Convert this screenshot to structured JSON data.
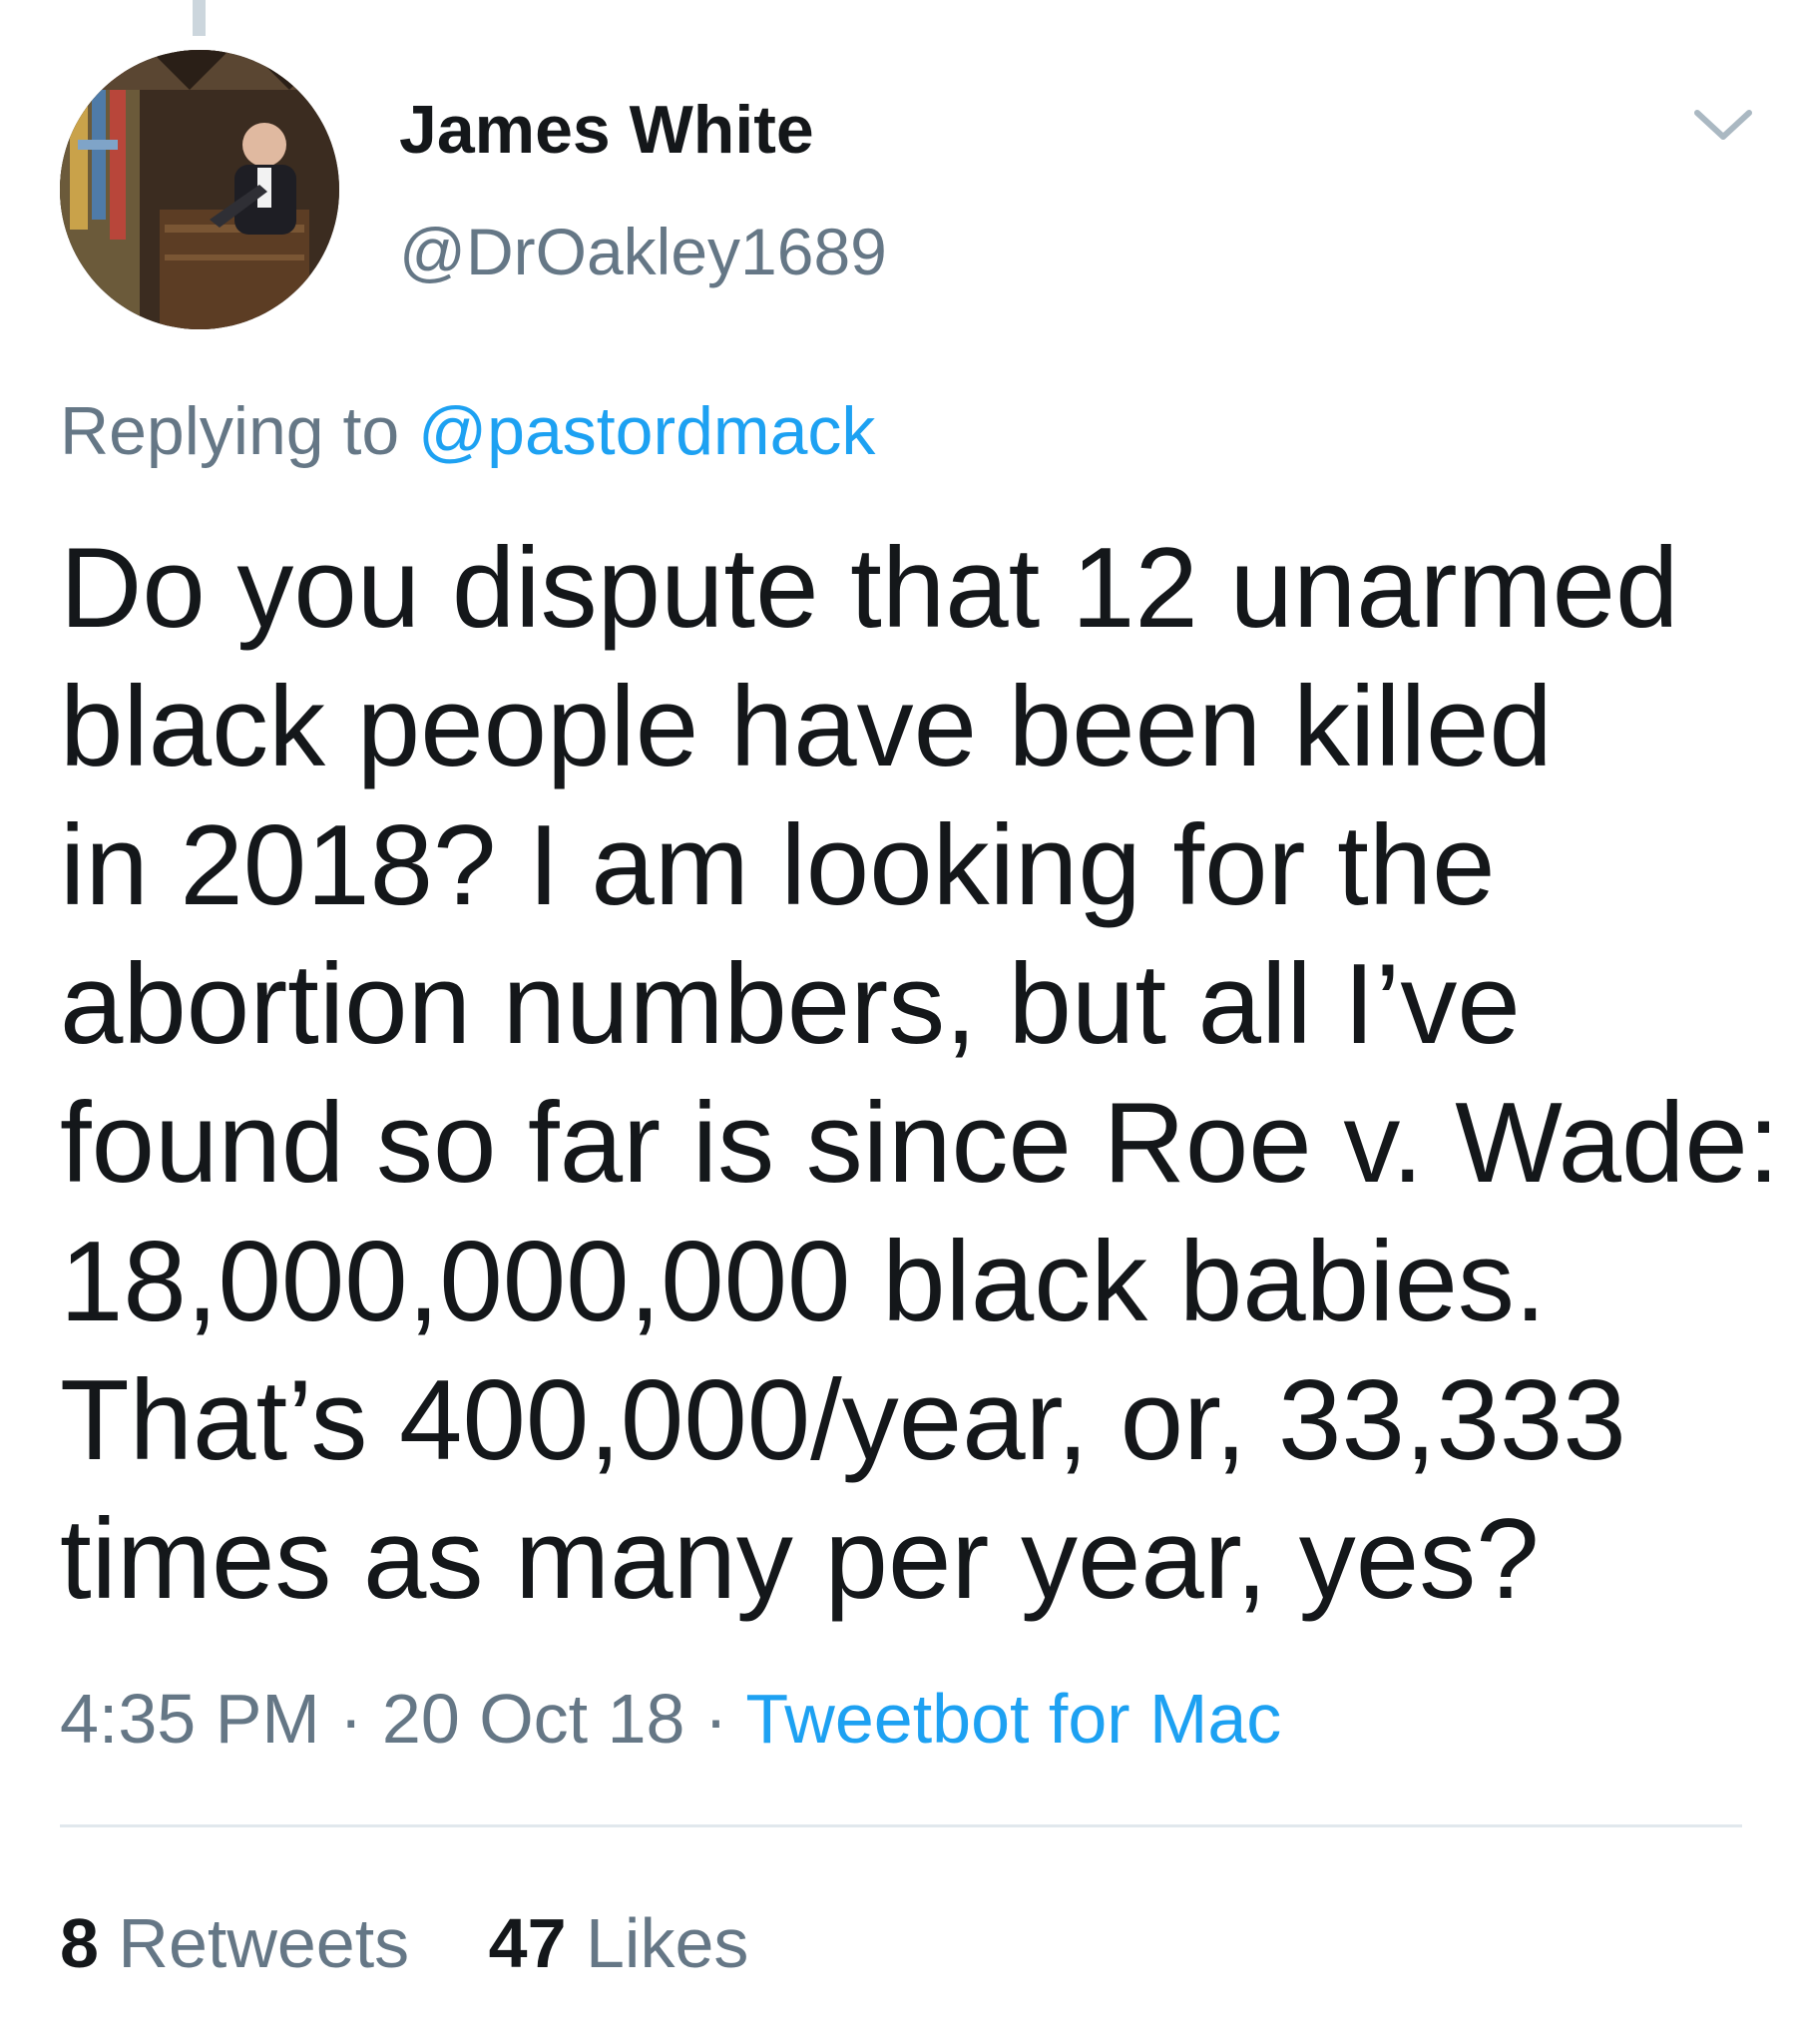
{
  "tweet": {
    "author_name": "James White",
    "author_handle": "@DrOakley1689",
    "replying_prefix": "Replying to ",
    "replying_to": "@pastordmack",
    "text_lines": [
      "Do you dispute that 12 unarmed",
      "black people have been killed",
      "in 2018? I am looking for the",
      "abortion numbers, but all I’ve",
      "found so far is since Roe v. Wade:",
      "18,000,000,000 black babies.",
      "That’s 400,000/year, or, 33,333",
      "times as many per year, yes?"
    ],
    "time": "4:35 PM",
    "separator": " · ",
    "date": "20 Oct 18",
    "source": "Tweetbot for Mac"
  },
  "stats": {
    "retweets_count": "8",
    "retweets_label": " Retweets",
    "likes_count": "47",
    "likes_label": " Likes"
  },
  "icons": {
    "menu": "chevron-down-icon",
    "avatar": "profile-photo"
  },
  "colors": {
    "text": "#14171a",
    "secondary": "#657786",
    "link": "#1da1f2",
    "divider": "#e1e8ed"
  }
}
